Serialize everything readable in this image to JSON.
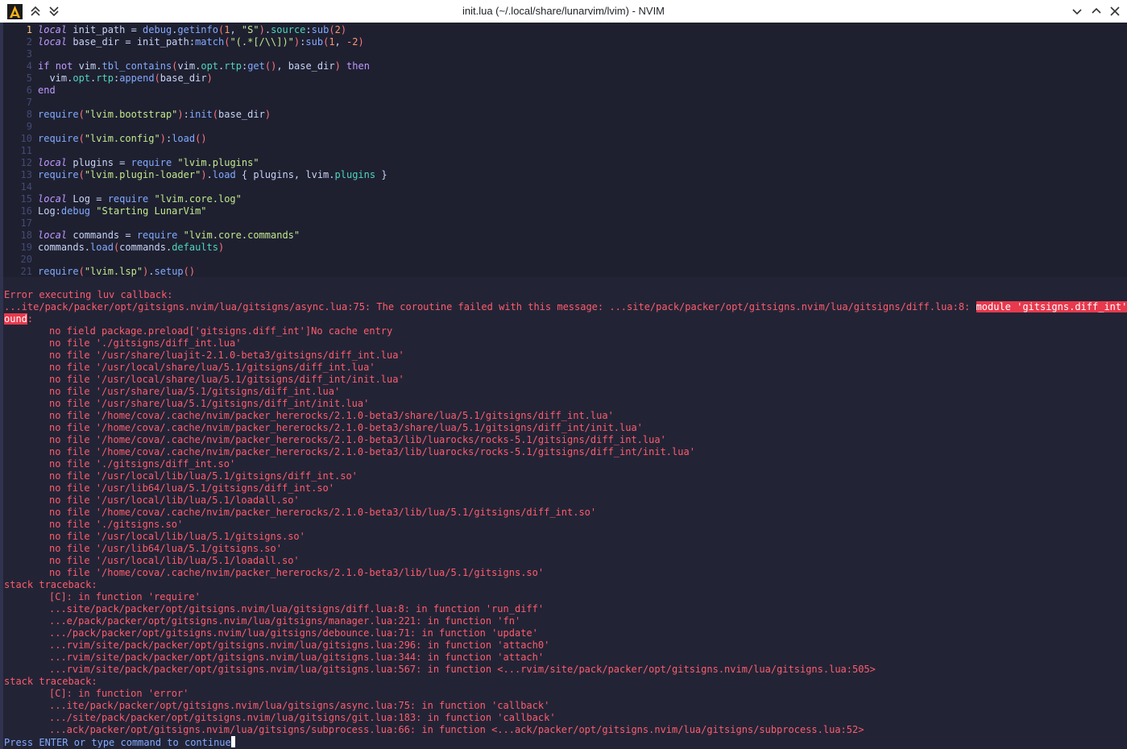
{
  "window": {
    "title": "init.lua (~/.local/share/lunarvim/lvim) - NVIM",
    "app_icon": "lunarvim-logo-icon",
    "buttons": [
      "chevron-up-double-icon",
      "chevron-down-double-icon",
      "minimize-icon",
      "maximize-icon",
      "close-icon"
    ]
  },
  "colors": {
    "keyword": "#c099ff",
    "function": "#82aaff",
    "string": "#c3e88d",
    "number": "#ff966c",
    "error": "#ff5c6c",
    "highlight": "#e8394d",
    "prompt": "#82aaff"
  },
  "editor": {
    "lines": [
      {
        "n": "1",
        "tokens": [
          [
            "kw",
            "local"
          ],
          [
            "var",
            " init_path = "
          ],
          [
            "fn",
            "debug"
          ],
          [
            "var",
            "."
          ],
          [
            "fn",
            "getinfo"
          ],
          [
            "par",
            "("
          ],
          [
            "num",
            "1"
          ],
          [
            "var",
            ", "
          ],
          [
            "str",
            "\"S\""
          ],
          [
            "par",
            ")"
          ],
          [
            "var",
            "."
          ],
          [
            "fld",
            "source"
          ],
          [
            "var",
            ":"
          ],
          [
            "fn",
            "sub"
          ],
          [
            "par",
            "("
          ],
          [
            "num",
            "2"
          ],
          [
            "par",
            ")"
          ]
        ]
      },
      {
        "n": "2",
        "tokens": [
          [
            "kw",
            "local"
          ],
          [
            "var",
            " base_dir = init_path:"
          ],
          [
            "fn",
            "match"
          ],
          [
            "par",
            "("
          ],
          [
            "str",
            "\"(.*[/\\\\])\""
          ],
          [
            "par",
            ")"
          ],
          [
            "var",
            ":"
          ],
          [
            "fn",
            "sub"
          ],
          [
            "par",
            "("
          ],
          [
            "num",
            "1"
          ],
          [
            "var",
            ", "
          ],
          [
            "num",
            "-2"
          ],
          [
            "par",
            ")"
          ]
        ]
      },
      {
        "n": "3",
        "tokens": []
      },
      {
        "n": "4",
        "tokens": [
          [
            "kwn",
            "if"
          ],
          [
            "var",
            " "
          ],
          [
            "kwn",
            "not"
          ],
          [
            "var",
            " vim."
          ],
          [
            "fn",
            "tbl_contains"
          ],
          [
            "par",
            "("
          ],
          [
            "var",
            "vim."
          ],
          [
            "fld",
            "opt"
          ],
          [
            "var",
            "."
          ],
          [
            "fld",
            "rtp"
          ],
          [
            "var",
            ":"
          ],
          [
            "fn",
            "get"
          ],
          [
            "par",
            "()"
          ],
          [
            "var",
            ", base_dir"
          ],
          [
            "par",
            ")"
          ],
          [
            "var",
            " "
          ],
          [
            "kwn",
            "then"
          ]
        ]
      },
      {
        "n": "5",
        "tokens": [
          [
            "var",
            "  vim."
          ],
          [
            "fld",
            "opt"
          ],
          [
            "var",
            "."
          ],
          [
            "fld",
            "rtp"
          ],
          [
            "var",
            ":"
          ],
          [
            "fn",
            "append"
          ],
          [
            "par",
            "("
          ],
          [
            "var",
            "base_dir"
          ],
          [
            "par",
            ")"
          ]
        ]
      },
      {
        "n": "6",
        "tokens": [
          [
            "kwn",
            "end"
          ]
        ]
      },
      {
        "n": "7",
        "tokens": []
      },
      {
        "n": "8",
        "tokens": [
          [
            "fn",
            "require"
          ],
          [
            "par",
            "("
          ],
          [
            "str",
            "\"lvim.bootstrap\""
          ],
          [
            "par",
            ")"
          ],
          [
            "var",
            ":"
          ],
          [
            "fn",
            "init"
          ],
          [
            "par",
            "("
          ],
          [
            "var",
            "base_dir"
          ],
          [
            "par",
            ")"
          ]
        ]
      },
      {
        "n": "9",
        "tokens": []
      },
      {
        "n": "10",
        "tokens": [
          [
            "fn",
            "require"
          ],
          [
            "par",
            "("
          ],
          [
            "str",
            "\"lvim.config\""
          ],
          [
            "par",
            ")"
          ],
          [
            "var",
            ":"
          ],
          [
            "fn",
            "load"
          ],
          [
            "par",
            "()"
          ]
        ]
      },
      {
        "n": "11",
        "tokens": []
      },
      {
        "n": "12",
        "tokens": [
          [
            "kw",
            "local"
          ],
          [
            "var",
            " plugins = "
          ],
          [
            "fn",
            "require"
          ],
          [
            "var",
            " "
          ],
          [
            "str",
            "\"lvim.plugins\""
          ]
        ]
      },
      {
        "n": "13",
        "tokens": [
          [
            "fn",
            "require"
          ],
          [
            "par",
            "("
          ],
          [
            "str",
            "\"lvim.plugin-loader\""
          ],
          [
            "par",
            ")"
          ],
          [
            "var",
            "."
          ],
          [
            "fn",
            "load"
          ],
          [
            "var",
            " { plugins, lvim."
          ],
          [
            "fld",
            "plugins"
          ],
          [
            "var",
            " }"
          ]
        ]
      },
      {
        "n": "14",
        "tokens": []
      },
      {
        "n": "15",
        "tokens": [
          [
            "kw",
            "local"
          ],
          [
            "var",
            " Log = "
          ],
          [
            "fn",
            "require"
          ],
          [
            "var",
            " "
          ],
          [
            "str",
            "\"lvim.core.log\""
          ]
        ]
      },
      {
        "n": "16",
        "tokens": [
          [
            "var",
            "Log:"
          ],
          [
            "fn",
            "debug"
          ],
          [
            "var",
            " "
          ],
          [
            "str",
            "\"Starting LunarVim\""
          ]
        ]
      },
      {
        "n": "17",
        "tokens": []
      },
      {
        "n": "18",
        "tokens": [
          [
            "kw",
            "local"
          ],
          [
            "var",
            " commands = "
          ],
          [
            "fn",
            "require"
          ],
          [
            "var",
            " "
          ],
          [
            "str",
            "\"lvim.core.commands\""
          ]
        ]
      },
      {
        "n": "19",
        "tokens": [
          [
            "var",
            "commands."
          ],
          [
            "fn",
            "load"
          ],
          [
            "par",
            "("
          ],
          [
            "var",
            "commands."
          ],
          [
            "fld",
            "defaults"
          ],
          [
            "par",
            ")"
          ]
        ]
      },
      {
        "n": "20",
        "tokens": []
      },
      {
        "n": "21",
        "tokens": [
          [
            "fn",
            "require"
          ],
          [
            "par",
            "("
          ],
          [
            "str",
            "\"lvim.lsp\""
          ],
          [
            "par",
            ")"
          ],
          [
            "var",
            "."
          ],
          [
            "fn",
            "setup"
          ],
          [
            "par",
            "()"
          ]
        ]
      }
    ]
  },
  "messages": {
    "header": "Error executing luv callback:",
    "error_prefix": "...ite/pack/packer/opt/gitsigns.nvim/lua/gitsigns/async.lua:75: The coroutine failed with this message: ...site/pack/packer/opt/gitsigns.nvim/lua/gitsigns/diff.lua:8: ",
    "error_highlight_1": "module 'gitsigns.diff_int' not f",
    "error_highlight_2": "ound",
    "error_suffix": ":",
    "search_lines": [
      "no field package.preload['gitsigns.diff_int']No cache entry",
      "no file './gitsigns/diff_int.lua'",
      "no file '/usr/share/luajit-2.1.0-beta3/gitsigns/diff_int.lua'",
      "no file '/usr/local/share/lua/5.1/gitsigns/diff_int.lua'",
      "no file '/usr/local/share/lua/5.1/gitsigns/diff_int/init.lua'",
      "no file '/usr/share/lua/5.1/gitsigns/diff_int.lua'",
      "no file '/usr/share/lua/5.1/gitsigns/diff_int/init.lua'",
      "no file '/home/cova/.cache/nvim/packer_hererocks/2.1.0-beta3/share/lua/5.1/gitsigns/diff_int.lua'",
      "no file '/home/cova/.cache/nvim/packer_hererocks/2.1.0-beta3/share/lua/5.1/gitsigns/diff_int/init.lua'",
      "no file '/home/cova/.cache/nvim/packer_hererocks/2.1.0-beta3/lib/luarocks/rocks-5.1/gitsigns/diff_int.lua'",
      "no file '/home/cova/.cache/nvim/packer_hererocks/2.1.0-beta3/lib/luarocks/rocks-5.1/gitsigns/diff_int/init.lua'",
      "no file './gitsigns/diff_int.so'",
      "no file '/usr/local/lib/lua/5.1/gitsigns/diff_int.so'",
      "no file '/usr/lib64/lua/5.1/gitsigns/diff_int.so'",
      "no file '/usr/local/lib/lua/5.1/loadall.so'",
      "no file '/home/cova/.cache/nvim/packer_hererocks/2.1.0-beta3/lib/lua/5.1/gitsigns/diff_int.so'",
      "no file './gitsigns.so'",
      "no file '/usr/local/lib/lua/5.1/gitsigns.so'",
      "no file '/usr/lib64/lua/5.1/gitsigns.so'",
      "no file '/usr/local/lib/lua/5.1/loadall.so'",
      "no file '/home/cova/.cache/nvim/packer_hererocks/2.1.0-beta3/lib/lua/5.1/gitsigns.so'"
    ],
    "traceback1_header": "stack traceback:",
    "traceback1": [
      "[C]: in function 'require'",
      "...site/pack/packer/opt/gitsigns.nvim/lua/gitsigns/diff.lua:8: in function 'run_diff'",
      "...e/pack/packer/opt/gitsigns.nvim/lua/gitsigns/manager.lua:221: in function 'fn'",
      ".../pack/packer/opt/gitsigns.nvim/lua/gitsigns/debounce.lua:71: in function 'update'",
      "...rvim/site/pack/packer/opt/gitsigns.nvim/lua/gitsigns.lua:296: in function 'attach0'",
      "...rvim/site/pack/packer/opt/gitsigns.nvim/lua/gitsigns.lua:344: in function 'attach'",
      "...rvim/site/pack/packer/opt/gitsigns.nvim/lua/gitsigns.lua:567: in function <...rvim/site/pack/packer/opt/gitsigns.nvim/lua/gitsigns.lua:505>"
    ],
    "traceback2_header": "stack traceback:",
    "traceback2": [
      "[C]: in function 'error'",
      "...ite/pack/packer/opt/gitsigns.nvim/lua/gitsigns/async.lua:75: in function 'callback'",
      ".../site/pack/packer/opt/gitsigns.nvim/lua/gitsigns/git.lua:183: in function 'callback'",
      "...ack/packer/opt/gitsigns.nvim/lua/gitsigns/subprocess.lua:66: in function <...ack/packer/opt/gitsigns.nvim/lua/gitsigns/subprocess.lua:52>"
    ],
    "prompt": "Press ENTER or type command to continue"
  }
}
